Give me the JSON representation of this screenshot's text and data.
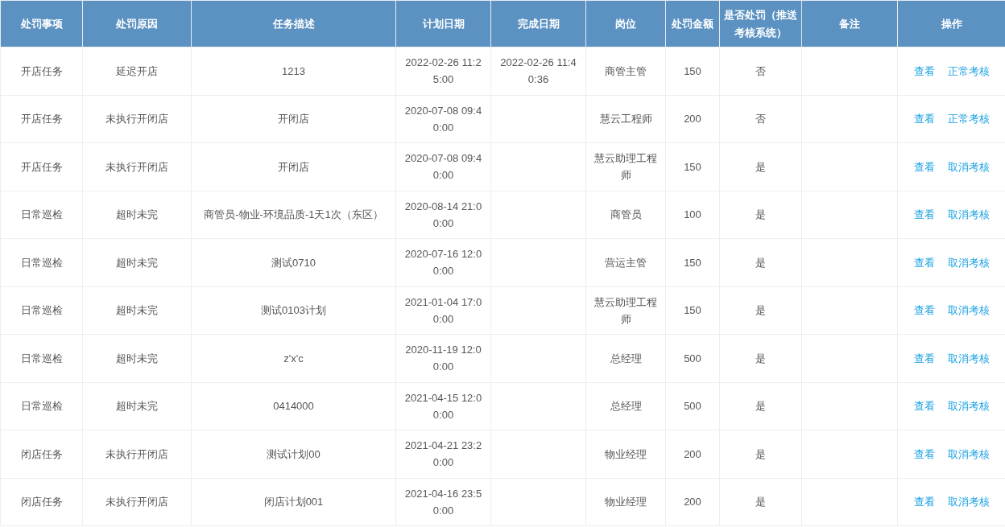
{
  "table": {
    "columns": [
      "处罚事项",
      "处罚原因",
      "任务描述",
      "计划日期",
      "完成日期",
      "岗位",
      "处罚金额",
      "是否处罚（推送考核系统）",
      "备注",
      "操作"
    ],
    "rows": [
      {
        "cells": [
          "开店任务",
          "延迟开店",
          "1213",
          "2022-02-26 11:25:00",
          "2022-02-26 11:40:36",
          "商管主管",
          "150",
          "否",
          ""
        ],
        "actions": [
          "查看",
          "正常考核"
        ]
      },
      {
        "cells": [
          "开店任务",
          "未执行开闭店",
          "开闭店",
          "2020-07-08 09:40:00",
          "",
          "慧云工程师",
          "200",
          "否",
          ""
        ],
        "actions": [
          "查看",
          "正常考核"
        ]
      },
      {
        "cells": [
          "开店任务",
          "未执行开闭店",
          "开闭店",
          "2020-07-08 09:40:00",
          "",
          "慧云助理工程师",
          "150",
          "是",
          ""
        ],
        "actions": [
          "查看",
          "取消考核"
        ]
      },
      {
        "cells": [
          "日常巡检",
          "超时未完",
          "商管员-物业-环境品质-1天1次（东区）",
          "2020-08-14 21:00:00",
          "",
          "商管员",
          "100",
          "是",
          ""
        ],
        "actions": [
          "查看",
          "取消考核"
        ]
      },
      {
        "cells": [
          "日常巡检",
          "超时未完",
          "测试0710",
          "2020-07-16 12:00:00",
          "",
          "营运主管",
          "150",
          "是",
          ""
        ],
        "actions": [
          "查看",
          "取消考核"
        ]
      },
      {
        "cells": [
          "日常巡检",
          "超时未完",
          "测试0103计划",
          "2021-01-04 17:00:00",
          "",
          "慧云助理工程师",
          "150",
          "是",
          ""
        ],
        "actions": [
          "查看",
          "取消考核"
        ]
      },
      {
        "cells": [
          "日常巡检",
          "超时未完",
          "z'x'c",
          "2020-11-19 12:00:00",
          "",
          "总经理",
          "500",
          "是",
          ""
        ],
        "actions": [
          "查看",
          "取消考核"
        ]
      },
      {
        "cells": [
          "日常巡检",
          "超时未完",
          "0414000",
          "2021-04-15 12:00:00",
          "",
          "总经理",
          "500",
          "是",
          ""
        ],
        "actions": [
          "查看",
          "取消考核"
        ]
      },
      {
        "cells": [
          "闭店任务",
          "未执行开闭店",
          "测试计划00",
          "2021-04-21 23:20:00",
          "",
          "物业经理",
          "200",
          "是",
          ""
        ],
        "actions": [
          "查看",
          "取消考核"
        ]
      },
      {
        "cells": [
          "闭店任务",
          "未执行开闭店",
          "闭店计划001",
          "2021-04-16 23:50:00",
          "",
          "物业经理",
          "200",
          "是",
          ""
        ],
        "actions": [
          "查看",
          "取消考核"
        ]
      }
    ]
  }
}
